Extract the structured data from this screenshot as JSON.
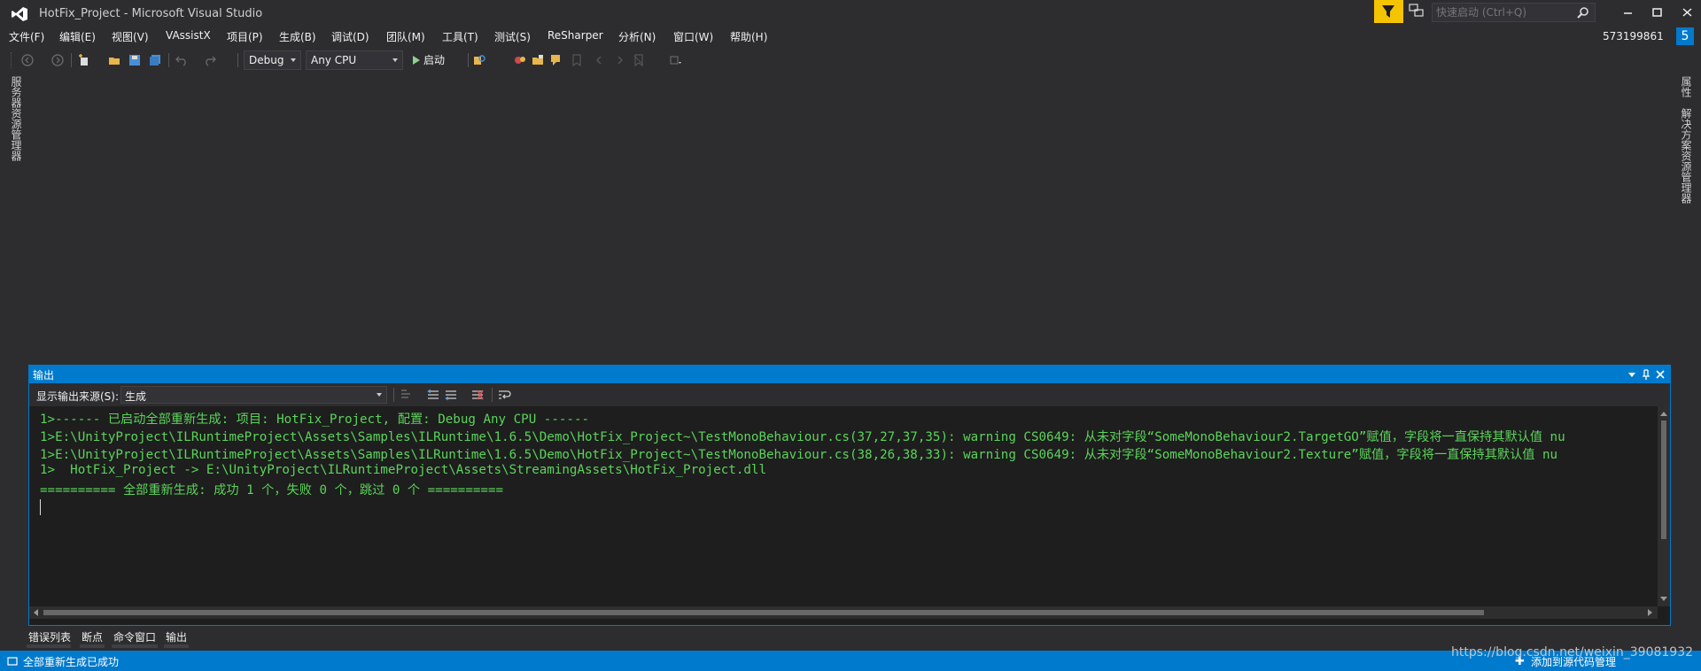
{
  "window": {
    "title": "HotFix_Project - Microsoft Visual Studio",
    "quick_launch_placeholder": "快速启动 (Ctrl+Q)",
    "user": "573199861",
    "notification_count": "5"
  },
  "menu": [
    {
      "label": "文件(F)"
    },
    {
      "label": "编辑(E)"
    },
    {
      "label": "视图(V)"
    },
    {
      "label": "VAssistX"
    },
    {
      "label": "项目(P)"
    },
    {
      "label": "生成(B)"
    },
    {
      "label": "调试(D)"
    },
    {
      "label": "团队(M)"
    },
    {
      "label": "工具(T)"
    },
    {
      "label": "测试(S)"
    },
    {
      "label": "ReSharper"
    },
    {
      "label": "分析(N)"
    },
    {
      "label": "窗口(W)"
    },
    {
      "label": "帮助(H)"
    }
  ],
  "toolbar": {
    "configuration": "Debug",
    "platform": "Any CPU",
    "start_label": "启动"
  },
  "side_tabs": {
    "left": "服务器资源管理器",
    "right_top": "属性",
    "right_bottom": "解决方案资源管理器"
  },
  "output": {
    "title": "输出",
    "source_label": "显示输出来源(S):",
    "source_value": "生成",
    "lines": [
      "1>------ 已启动全部重新生成: 项目: HotFix_Project, 配置: Debug Any CPU ------",
      "1>E:\\UnityProject\\ILRuntimeProject\\Assets\\Samples\\ILRuntime\\1.6.5\\Demo\\HotFix_Project~\\TestMonoBehaviour.cs(37,27,37,35): warning CS0649: 从未对字段“SomeMonoBehaviour2.TargetGO”赋值，字段将一直保持其默认值 nu",
      "1>E:\\UnityProject\\ILRuntimeProject\\Assets\\Samples\\ILRuntime\\1.6.5\\Demo\\HotFix_Project~\\TestMonoBehaviour.cs(38,26,38,33): warning CS0649: 从未对字段“SomeMonoBehaviour2.Texture”赋值，字段将一直保持其默认值 nu",
      "1>  HotFix_Project -> E:\\UnityProject\\ILRuntimeProject\\Assets\\StreamingAssets\\HotFix_Project.dll",
      "========== 全部重新生成: 成功 1 个，失败 0 个，跳过 0 个 =========="
    ]
  },
  "bottom_tabs": [
    {
      "label": "错误列表"
    },
    {
      "label": "断点"
    },
    {
      "label": "命令窗口"
    },
    {
      "label": "输出"
    }
  ],
  "status": {
    "message": "全部重新生成已成功",
    "right_action": "添加到源代码管理",
    "watermark": "https://blog.csdn.net/weixin_39081932"
  },
  "colors": {
    "accent": "#007acc",
    "background": "#2d2d30",
    "editor": "#1e1e1e",
    "output_text": "#5bd45b",
    "filter_yellow": "#f5c400"
  },
  "icons": [
    "visual-studio-logo-icon",
    "filter-icon",
    "feedback-icon",
    "search-icon",
    "minimize-icon",
    "maximize-icon",
    "close-icon",
    "back-icon",
    "forward-icon",
    "new-project-icon",
    "open-file-icon",
    "save-icon",
    "save-all-icon",
    "undo-icon",
    "redo-icon",
    "play-icon"
  ]
}
